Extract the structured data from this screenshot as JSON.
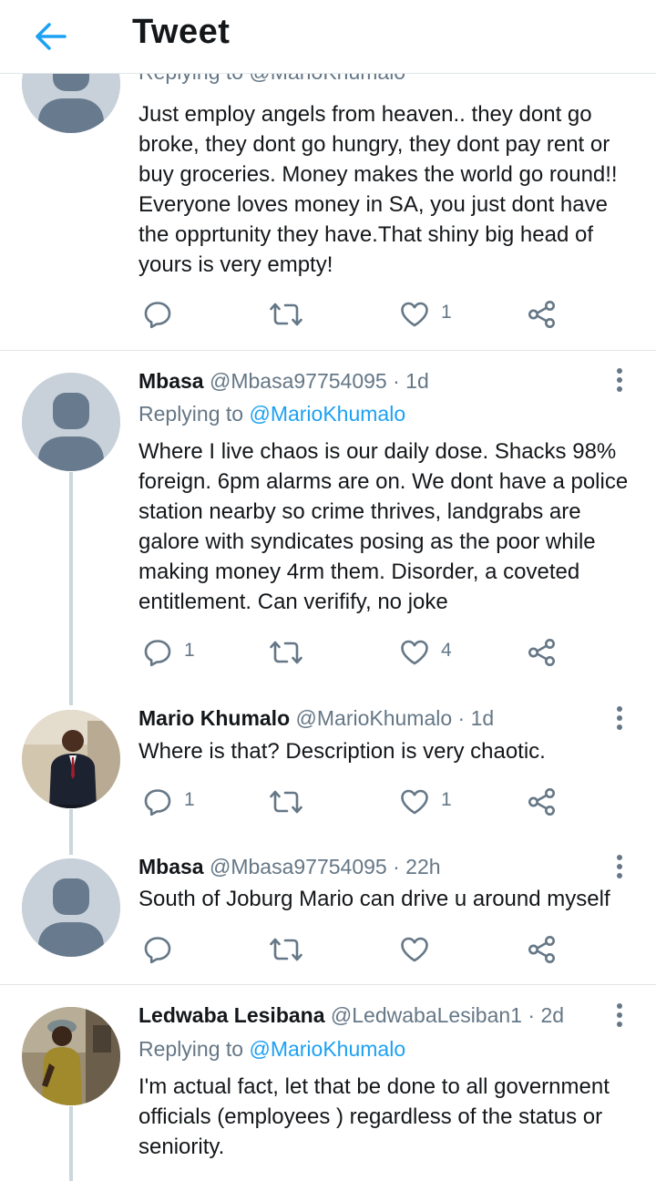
{
  "header": {
    "title": "Tweet"
  },
  "tweets": [
    {
      "partial_reply_to": "Replying to @MarioKhumalo",
      "text": "Just employ angels from heaven.. they dont go broke, they dont go hungry, they dont pay rent or buy groceries. Money makes the world go round!! Everyone loves money in SA, you just dont have the opprtunity they have.That shiny big head of yours is very empty!",
      "reply_count": "",
      "retweet_count": "",
      "like_count": "1"
    },
    {
      "name": "Mbasa",
      "handle": "@Mbasa97754095",
      "dot": "·",
      "time": "1d",
      "replying_label": "Replying to",
      "replying_to": "@MarioKhumalo",
      "text": "Where I live chaos is our daily dose. Shacks 98% foreign. 6pm alarms are on. We dont have a police station nearby so crime thrives, landgrabs are galore with syndicates posing as the poor while making money 4rm them. Disorder, a coveted entitlement. Can verifify, no joke",
      "reply_count": "1",
      "retweet_count": "",
      "like_count": "4"
    },
    {
      "name": "Mario Khumalo",
      "handle": "@MarioKhumalo",
      "dot": "·",
      "time": "1d",
      "text": "Where is that? Description is very chaotic.",
      "reply_count": "1",
      "retweet_count": "",
      "like_count": "1"
    },
    {
      "name": "Mbasa",
      "handle": "@Mbasa97754095",
      "dot": "·",
      "time": "22h",
      "text": "South of Joburg Mario can drive u around myself",
      "reply_count": "",
      "retweet_count": "",
      "like_count": ""
    },
    {
      "name": "Ledwaba Lesibana",
      "handle": "@LedwabaLesiban1",
      "dot": "·",
      "time": "2d",
      "replying_label": "Replying to",
      "replying_to": "@MarioKhumalo",
      "text": "I'm actual fact, let that be done to all government officials (employees ) regardless of the status or seniority."
    }
  ],
  "colors": {
    "accent": "#1da1f2",
    "muted": "#657786",
    "text": "#14171a",
    "divider": "#e1e8ed"
  },
  "icons": [
    "back-arrow-icon",
    "reply-icon",
    "retweet-icon",
    "like-icon",
    "share-icon",
    "more-icon"
  ]
}
